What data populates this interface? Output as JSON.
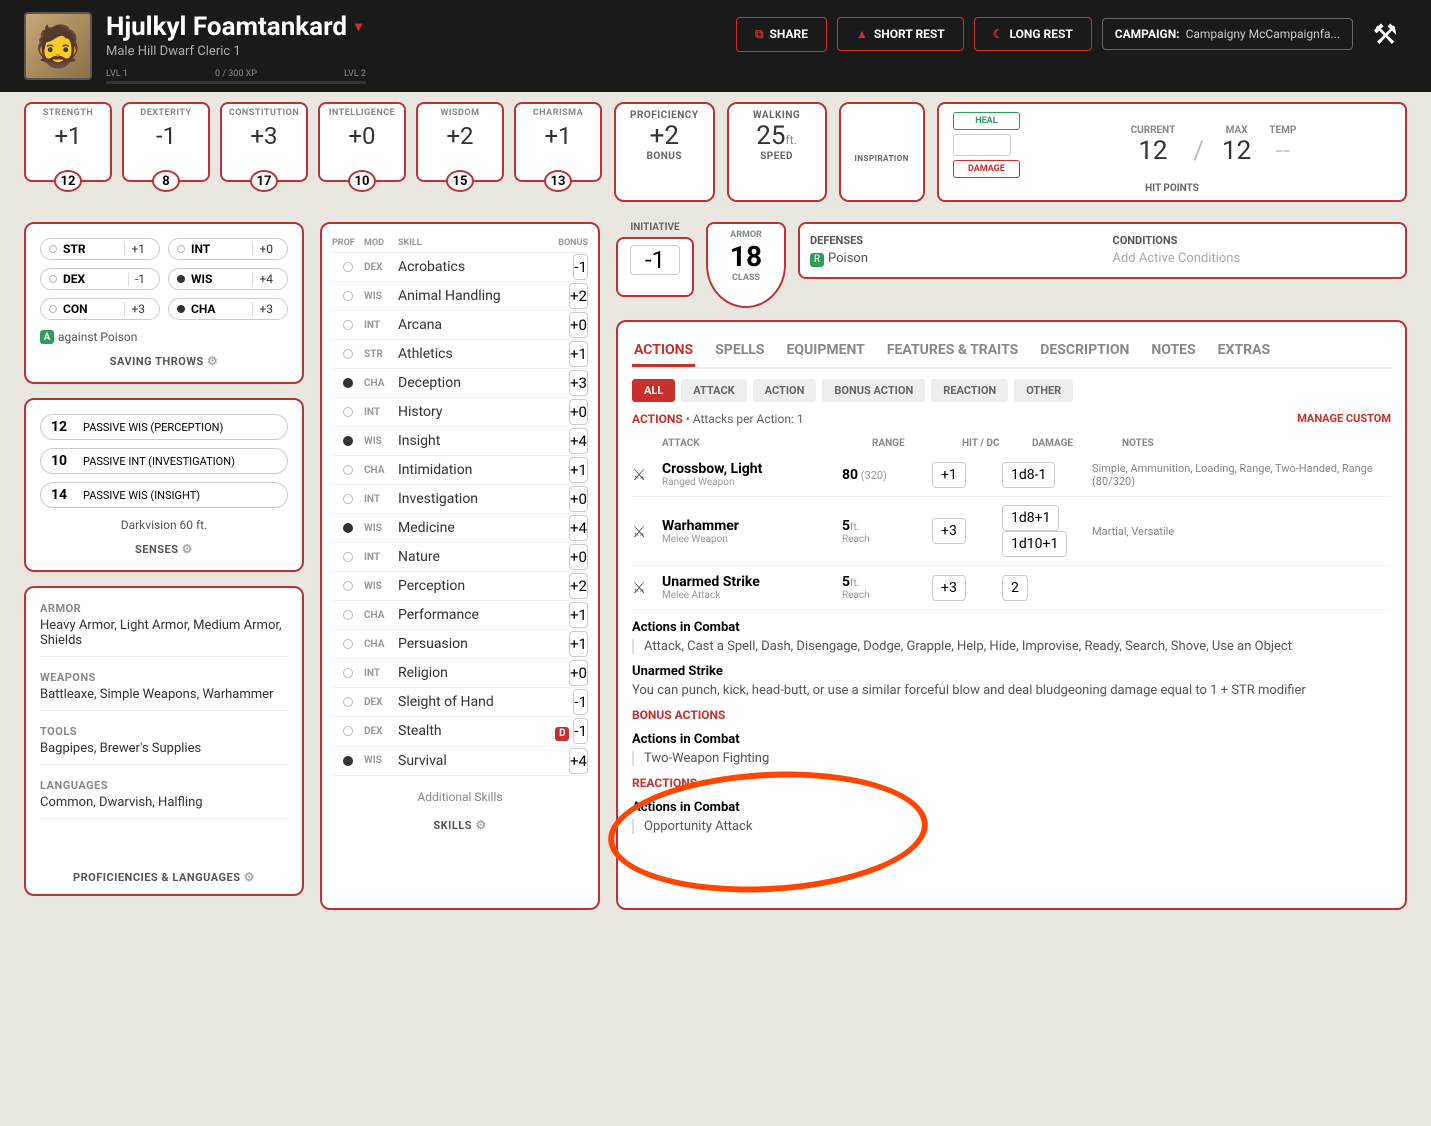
{
  "header": {
    "name": "Hjulkyl Foamtankard",
    "subtitle": "Male  Hill Dwarf  Cleric 1",
    "lvl_left": "LVL 1",
    "lvl_right": "LVL 2",
    "xp": "0 / 300 XP",
    "share": "SHARE",
    "short_rest": "SHORT REST",
    "long_rest": "LONG REST",
    "campaign_label": "CAMPAIGN:",
    "campaign_name": "Campaigny McCampaignfa..."
  },
  "abilities": [
    {
      "label": "STRENGTH",
      "mod": "+1",
      "score": "12"
    },
    {
      "label": "DEXTERITY",
      "mod": "-1",
      "score": "8"
    },
    {
      "label": "CONSTITUTION",
      "mod": "+3",
      "score": "17"
    },
    {
      "label": "INTELLIGENCE",
      "mod": "+0",
      "score": "10"
    },
    {
      "label": "WISDOM",
      "mod": "+2",
      "score": "15"
    },
    {
      "label": "CHARISMA",
      "mod": "+1",
      "score": "13"
    }
  ],
  "proficiency": {
    "label": "PROFICIENCY",
    "value": "+2",
    "sub": "BONUS"
  },
  "speed": {
    "label": "WALKING",
    "value": "25",
    "unit": "ft.",
    "sub": "SPEED"
  },
  "inspiration": "INSPIRATION",
  "hp": {
    "heal": "HEAL",
    "damage": "DAMAGE",
    "current_label": "CURRENT",
    "current": "12",
    "max_label": "MAX",
    "max": "12",
    "temp_label": "TEMP",
    "temp": "--",
    "title": "HIT POINTS"
  },
  "saves": {
    "title": "SAVING THROWS",
    "items": [
      {
        "ab": "STR",
        "bonus": "+1",
        "prof": false
      },
      {
        "ab": "INT",
        "bonus": "+0",
        "prof": false
      },
      {
        "ab": "DEX",
        "bonus": "-1",
        "prof": false
      },
      {
        "ab": "WIS",
        "bonus": "+4",
        "prof": true
      },
      {
        "ab": "CON",
        "bonus": "+3",
        "prof": false
      },
      {
        "ab": "CHA",
        "bonus": "+3",
        "prof": true
      }
    ],
    "note": "against Poison"
  },
  "senses": {
    "title": "SENSES",
    "items": [
      {
        "val": "12",
        "label": "PASSIVE WIS (PERCEPTION)"
      },
      {
        "val": "10",
        "label": "PASSIVE INT (INVESTIGATION)"
      },
      {
        "val": "14",
        "label": "PASSIVE WIS (INSIGHT)"
      }
    ],
    "extra": "Darkvision 60 ft."
  },
  "profs": {
    "title": "PROFICIENCIES & LANGUAGES",
    "blocks": [
      {
        "h": "ARMOR",
        "v": "Heavy Armor, Light Armor, Medium Armor, Shields"
      },
      {
        "h": "WEAPONS",
        "v": "Battleaxe, Simple Weapons, Warhammer"
      },
      {
        "h": "TOOLS",
        "v": "Bagpipes, Brewer's Supplies"
      },
      {
        "h": "LANGUAGES",
        "v": "Common, Dwarvish, Halfling"
      }
    ]
  },
  "skills": {
    "title": "SKILLS",
    "additional": "Additional Skills",
    "header": {
      "prof": "PROF",
      "mod": "MOD",
      "skill": "SKILL",
      "bonus": "BONUS"
    },
    "items": [
      {
        "prof": false,
        "mod": "DEX",
        "name": "Acrobatics",
        "bonus": "-1"
      },
      {
        "prof": false,
        "mod": "WIS",
        "name": "Animal Handling",
        "bonus": "+2"
      },
      {
        "prof": false,
        "mod": "INT",
        "name": "Arcana",
        "bonus": "+0"
      },
      {
        "prof": false,
        "mod": "STR",
        "name": "Athletics",
        "bonus": "+1"
      },
      {
        "prof": true,
        "mod": "CHA",
        "name": "Deception",
        "bonus": "+3"
      },
      {
        "prof": false,
        "mod": "INT",
        "name": "History",
        "bonus": "+0"
      },
      {
        "prof": true,
        "mod": "WIS",
        "name": "Insight",
        "bonus": "+4"
      },
      {
        "prof": false,
        "mod": "CHA",
        "name": "Intimidation",
        "bonus": "+1"
      },
      {
        "prof": false,
        "mod": "INT",
        "name": "Investigation",
        "bonus": "+0"
      },
      {
        "prof": true,
        "mod": "WIS",
        "name": "Medicine",
        "bonus": "+4"
      },
      {
        "prof": false,
        "mod": "INT",
        "name": "Nature",
        "bonus": "+0"
      },
      {
        "prof": false,
        "mod": "WIS",
        "name": "Perception",
        "bonus": "+2"
      },
      {
        "prof": false,
        "mod": "CHA",
        "name": "Performance",
        "bonus": "+1"
      },
      {
        "prof": false,
        "mod": "CHA",
        "name": "Persuasion",
        "bonus": "+1"
      },
      {
        "prof": false,
        "mod": "INT",
        "name": "Religion",
        "bonus": "+0"
      },
      {
        "prof": false,
        "mod": "DEX",
        "name": "Sleight of Hand",
        "bonus": "-1"
      },
      {
        "prof": false,
        "mod": "DEX",
        "name": "Stealth",
        "bonus": "-1",
        "disadv": true
      },
      {
        "prof": true,
        "mod": "WIS",
        "name": "Survival",
        "bonus": "+4"
      }
    ]
  },
  "initiative": {
    "label": "INITIATIVE",
    "value": "-1"
  },
  "armor": {
    "label": "ARMOR",
    "value": "18",
    "sub": "CLASS"
  },
  "defenses": {
    "label": "DEFENSES",
    "value": "Poison"
  },
  "conditions": {
    "label": "CONDITIONS",
    "value": "Add Active Conditions"
  },
  "main_tabs": [
    "ACTIONS",
    "SPELLS",
    "EQUIPMENT",
    "FEATURES & TRAITS",
    "DESCRIPTION",
    "NOTES",
    "EXTRAS"
  ],
  "sub_tabs": [
    "ALL",
    "ATTACK",
    "ACTION",
    "BONUS ACTION",
    "REACTION",
    "OTHER"
  ],
  "actions": {
    "header": "ACTIONS",
    "per": "Attacks per Action: 1",
    "manage": "MANAGE CUSTOM",
    "cols": {
      "attack": "ATTACK",
      "range": "RANGE",
      "hit": "HIT / DC",
      "damage": "DAMAGE",
      "notes": "NOTES"
    },
    "rows": [
      {
        "name": "Crossbow, Light",
        "sub": "Ranged Weapon",
        "range": "80",
        "range_sub": "(320)",
        "hit": "+1",
        "dmg": [
          "1d8-1"
        ],
        "notes": "Simple, Ammunition, Loading, Range, Two-Handed, Range (80/320)"
      },
      {
        "name": "Warhammer",
        "sub": "Melee Weapon",
        "range": "5",
        "range_unit": "ft.",
        "range_sub": "Reach",
        "hit": "+3",
        "dmg": [
          "1d8+1",
          "1d10+1"
        ],
        "notes": "Martial, Versatile"
      },
      {
        "name": "Unarmed Strike",
        "sub": "Melee Attack",
        "range": "5",
        "range_unit": "ft.",
        "range_sub": "Reach",
        "hit": "+3",
        "dmg": [
          "2"
        ],
        "notes": ""
      }
    ],
    "combat_h": "Actions in Combat",
    "combat_list": "Attack, Cast a Spell, Dash, Disengage, Dodge, Grapple, Help, Hide, Improvise, Ready, Search, Shove, Use an Object",
    "unarmed_h": "Unarmed Strike",
    "unarmed_body": "You can punch, kick, head-butt, or use a similar forceful blow and deal bludgeoning damage equal to 1 + STR modifier",
    "bonus_h": "BONUS ACTIONS",
    "bonus_combat_h": "Actions in Combat",
    "bonus_body": "Two-Weapon Fighting",
    "react_h": "REACTIONS",
    "react_combat_h": "Actions in Combat",
    "react_body": "Opportunity Attack"
  }
}
